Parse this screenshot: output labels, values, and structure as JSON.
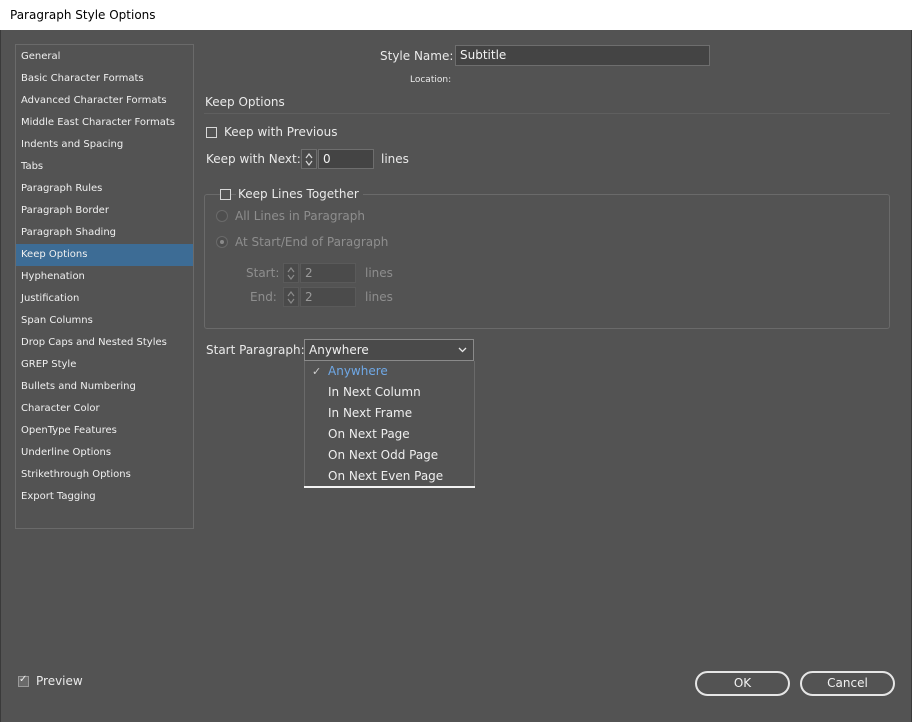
{
  "window": {
    "title": "Paragraph Style Options"
  },
  "nav": {
    "items": [
      {
        "label": "General"
      },
      {
        "label": "Basic Character Formats"
      },
      {
        "label": "Advanced Character Formats"
      },
      {
        "label": "Middle East Character Formats"
      },
      {
        "label": "Indents and Spacing"
      },
      {
        "label": "Tabs"
      },
      {
        "label": "Paragraph Rules"
      },
      {
        "label": "Paragraph Border"
      },
      {
        "label": "Paragraph Shading"
      },
      {
        "label": "Keep Options"
      },
      {
        "label": "Hyphenation"
      },
      {
        "label": "Justification"
      },
      {
        "label": "Span Columns"
      },
      {
        "label": "Drop Caps and Nested Styles"
      },
      {
        "label": "GREP Style"
      },
      {
        "label": "Bullets and Numbering"
      },
      {
        "label": "Character Color"
      },
      {
        "label": "OpenType Features"
      },
      {
        "label": "Underline Options"
      },
      {
        "label": "Strikethrough Options"
      },
      {
        "label": "Export Tagging"
      }
    ],
    "selected": "Keep Options"
  },
  "header": {
    "style_name_label": "Style Name:",
    "style_name_value": "Subtitle",
    "location_label": "Location:"
  },
  "section": {
    "title": "Keep Options"
  },
  "keep": {
    "keep_with_previous_label": "Keep with Previous",
    "keep_with_previous_checked": false,
    "keep_with_next_label": "Keep with Next:",
    "keep_with_next_value": "0",
    "keep_with_next_unit": "lines"
  },
  "lines_together": {
    "label": "Keep Lines Together",
    "checked": false,
    "all_lines_label": "All Lines in Paragraph",
    "start_end_label": "At Start/End of Paragraph",
    "start_label": "Start:",
    "start_value": "2",
    "start_unit": "lines",
    "end_label": "End:",
    "end_value": "2",
    "end_unit": "lines"
  },
  "start_paragraph": {
    "label": "Start Paragraph:",
    "value": "Anywhere",
    "options": [
      {
        "label": "Anywhere",
        "selected": true
      },
      {
        "label": "In Next Column"
      },
      {
        "label": "In Next Frame"
      },
      {
        "label": "On Next Page"
      },
      {
        "label": "On Next Odd Page"
      },
      {
        "label": "On Next Even Page"
      }
    ],
    "selected_color": "#6fa8e6"
  },
  "footer": {
    "preview_label": "Preview",
    "preview_checked": true,
    "ok_label": "OK",
    "cancel_label": "Cancel"
  },
  "colors": {
    "background": "#535353",
    "nav_selected": "#3d6c95"
  }
}
